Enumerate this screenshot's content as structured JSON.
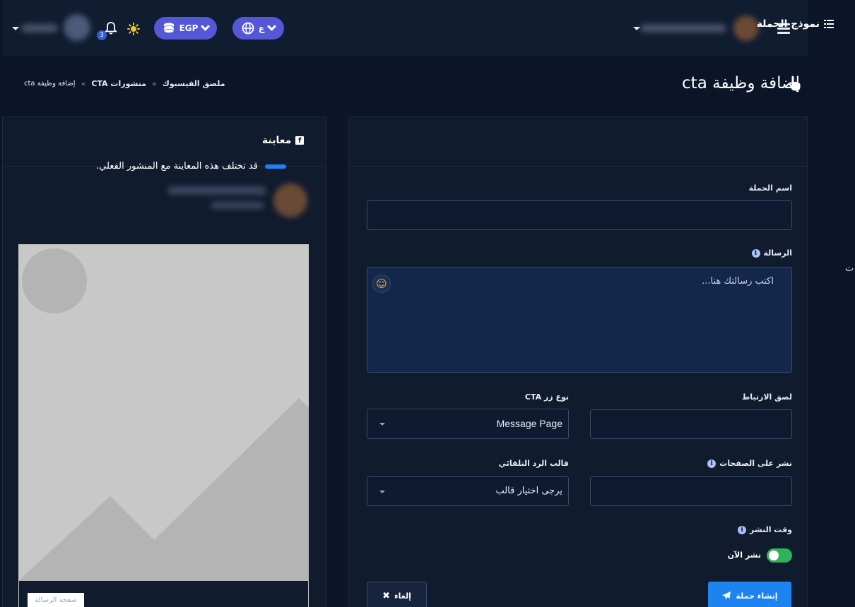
{
  "header": {
    "currency": "EGP",
    "language": "ع",
    "notification_count": "3"
  },
  "page": {
    "title": "إضافة وظيفة cta",
    "breadcrumb": [
      "ملصق الفيسبوك",
      "منشورات CTA",
      "إضافة وظيفة cta"
    ],
    "breadcrumb_sep": "»",
    "cut_text": "ت"
  },
  "form": {
    "title": "نموذج الحملة",
    "campaign_name_label": "اسم الحملة",
    "campaign_name_value": "",
    "message_label": "الرسالة",
    "message_placeholder": "اكتب رسالتك هنا...",
    "link_label": "لصق الارتباط",
    "link_value": "",
    "cta_type_label": "نوع زر CTA",
    "cta_type_value": "Message Page",
    "pages_label": "نشر على الصفحات",
    "pages_value": "",
    "auto_reply_label": "قالب الرد التلقائي",
    "auto_reply_value": "يرجى اختيار قالب",
    "post_time_label": "وقت النشر",
    "post_now_label": "نشر الآن",
    "create_button": "إنشاء حملة",
    "cancel_button": "إلغاء"
  },
  "preview": {
    "title": "معاينة",
    "note": "قد تختلف هذه المعاينة مع المنشور الفعلي.",
    "page_button": "صفحة الرسالة"
  }
}
